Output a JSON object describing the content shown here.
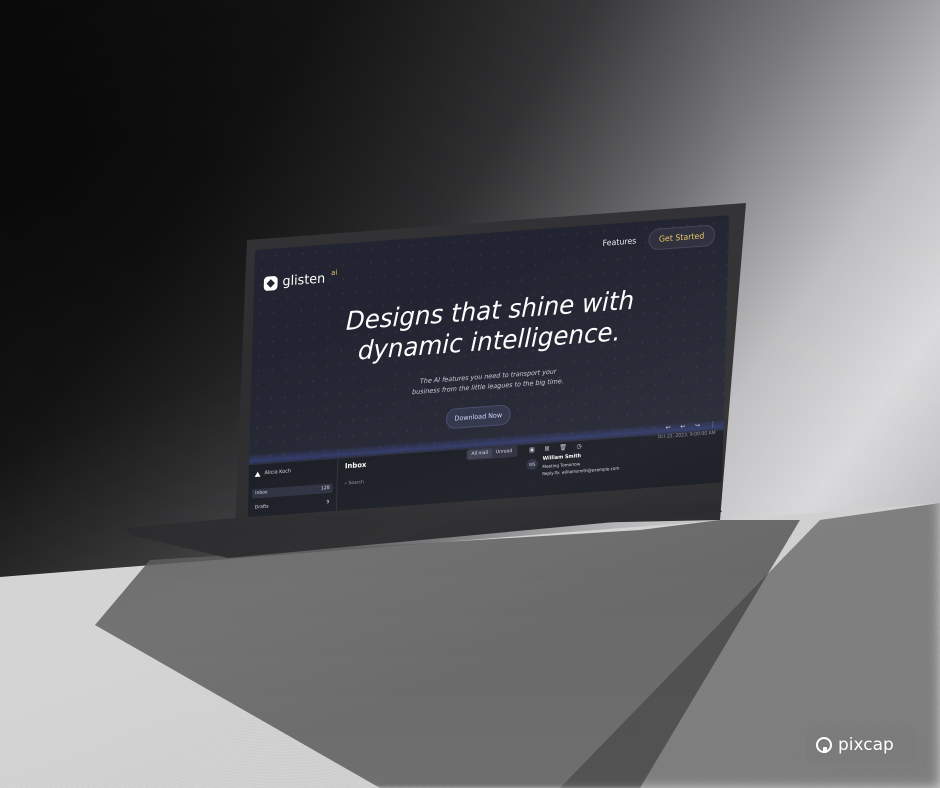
{
  "nav": {
    "features": "Features",
    "get_started": "Get Started"
  },
  "brand": {
    "name": "glisten",
    "sup": "ai"
  },
  "hero": {
    "title_line1": "Designs that shine with",
    "title_line2": "dynamic intelligence.",
    "sub_line1": "The AI features you need to transport your",
    "sub_line2": "business from the little leagues to the big time.",
    "cta": "Download Now"
  },
  "mail": {
    "account": "Alicia Koch",
    "sidebar": [
      {
        "label": "Inbox",
        "count": "128"
      },
      {
        "label": "Drafts",
        "count": "9"
      }
    ],
    "title": "Inbox",
    "tabs": [
      "All mail",
      "Unread"
    ],
    "search_placeholder": "Search",
    "message": {
      "date": "Oct 22, 2023, 9:00:00 AM",
      "avatar": "WS",
      "sender": "William Smith",
      "subject": "Meeting Tomorrow",
      "reply_to": "Reply-To: williamsmith@example.com"
    }
  },
  "watermark": {
    "text": "pixcap"
  },
  "colors": {
    "accent": "#e7c86a",
    "screen_bg": "#222431",
    "button_text": "#cfd6ff"
  }
}
